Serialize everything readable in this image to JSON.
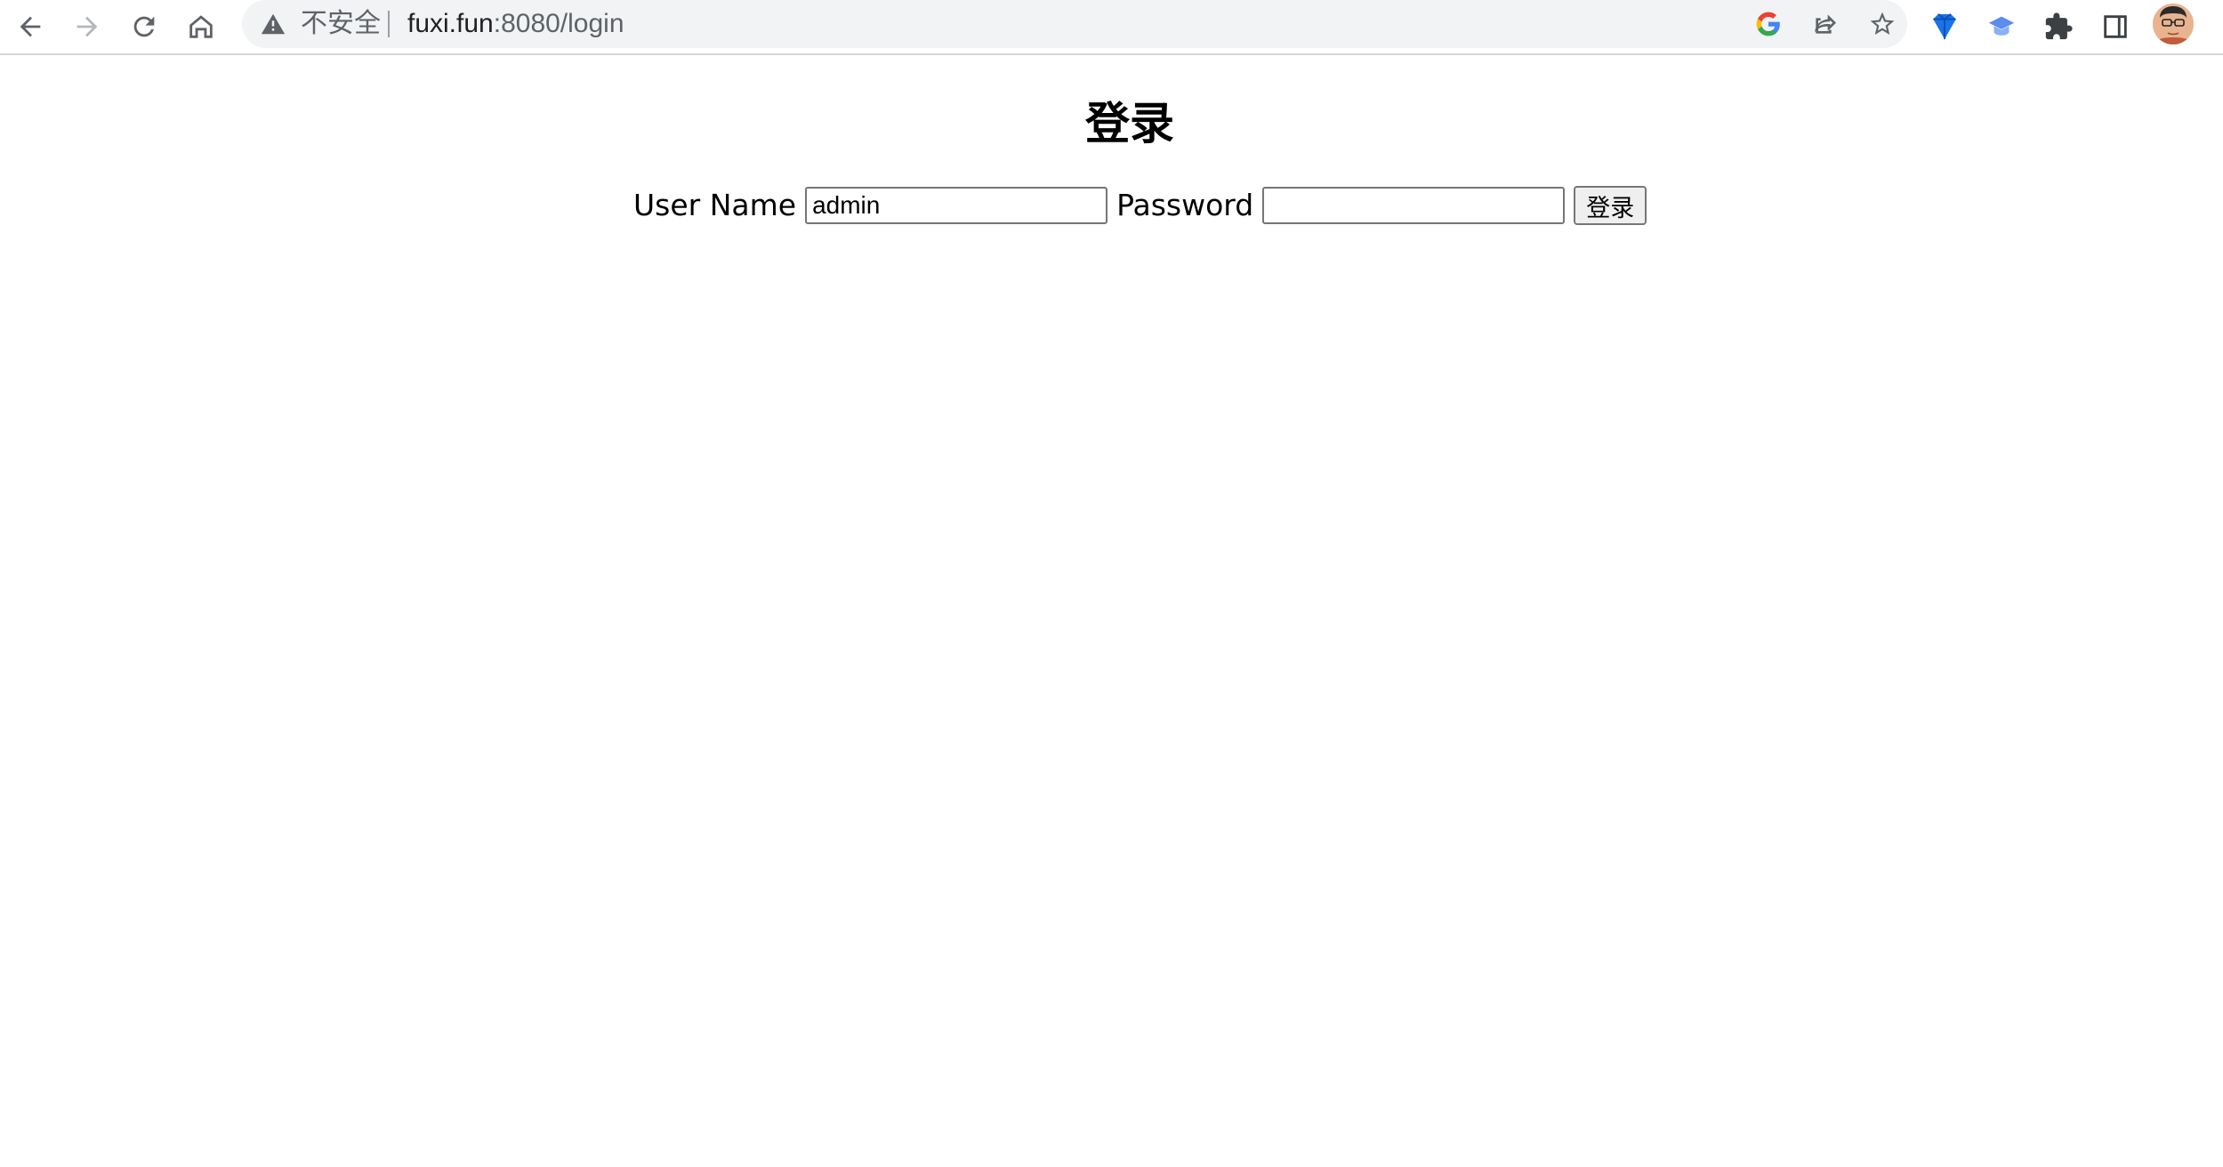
{
  "browser": {
    "security_label": "不安全",
    "url_host": "fuxi.fun",
    "url_rest": ":8080/login",
    "icons": {
      "back": "arrow-left-icon",
      "forward": "arrow-right-icon",
      "reload": "reload-icon",
      "home": "home-icon",
      "warning": "warning-triangle-icon",
      "google": "google-icon",
      "share": "share-icon",
      "bookmark": "star-icon",
      "extension_1": "gem-extension-icon",
      "extension_2": "graduation-cap-extension-icon",
      "extensions": "puzzle-icon",
      "side_panel": "side-panel-icon",
      "profile": "profile-avatar"
    }
  },
  "page": {
    "title": "登录",
    "username_label": "User Name",
    "username_value": "admin",
    "password_label": "Password",
    "password_value": "",
    "submit_label": "登录"
  }
}
